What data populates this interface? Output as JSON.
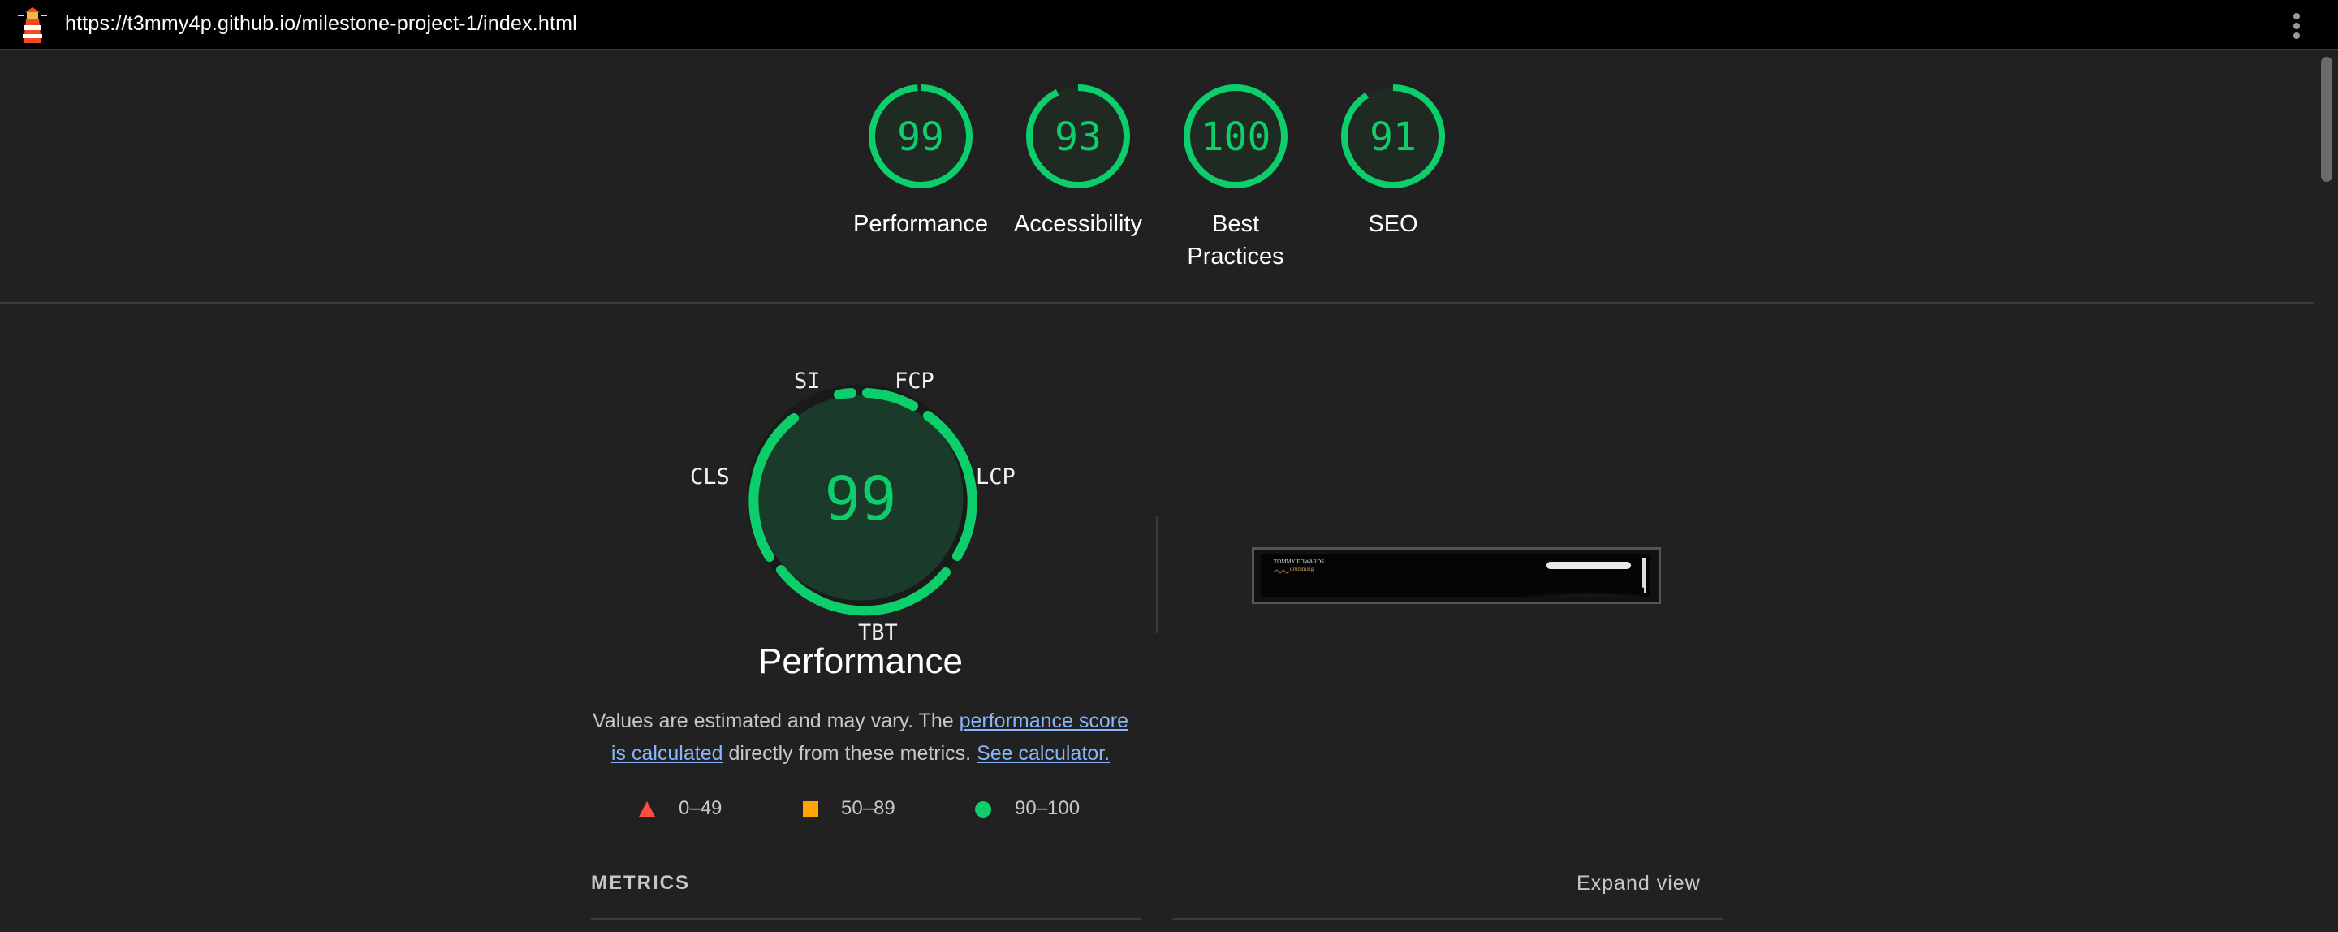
{
  "topbar": {
    "url": "https://t3mmy4p.github.io/milestone-project-1/index.html",
    "logo_icon": "lighthouse-icon",
    "menu_icon": "kebab-menu-icon"
  },
  "colors": {
    "pass": "#0cce6b",
    "average": "#ffa400",
    "fail": "#ff4e42",
    "background": "#212121",
    "link": "#8ab4f8"
  },
  "scores": [
    {
      "label": "Performance",
      "value": 99
    },
    {
      "label": "Accessibility",
      "value": 93
    },
    {
      "label": "Best Practices",
      "value": 100
    },
    {
      "label": "SEO",
      "value": 91
    }
  ],
  "performance": {
    "score": "99",
    "title": "Performance",
    "metric_labels": {
      "si": "SI",
      "fcp": "FCP",
      "lcp": "LCP",
      "tbt": "TBT",
      "cls": "CLS"
    },
    "desc_part1": "Values are estimated and may vary. The ",
    "desc_link1": "performance score is calculated",
    "desc_part2": " directly from these metrics. ",
    "desc_link2": "See calculator."
  },
  "legend": [
    {
      "range": "0–49",
      "shape": "triangle",
      "color": "#ff4e42"
    },
    {
      "range": "50–89",
      "shape": "square",
      "color": "#ffa400"
    },
    {
      "range": "90–100",
      "shape": "circle",
      "color": "#0cce6b"
    }
  ],
  "metrics": {
    "heading": "METRICS",
    "expand_label": "Expand view"
  },
  "screenshot_thumbnail": {
    "site_title": "TOMMY EDWARDS",
    "site_subtitle": "drumming"
  }
}
